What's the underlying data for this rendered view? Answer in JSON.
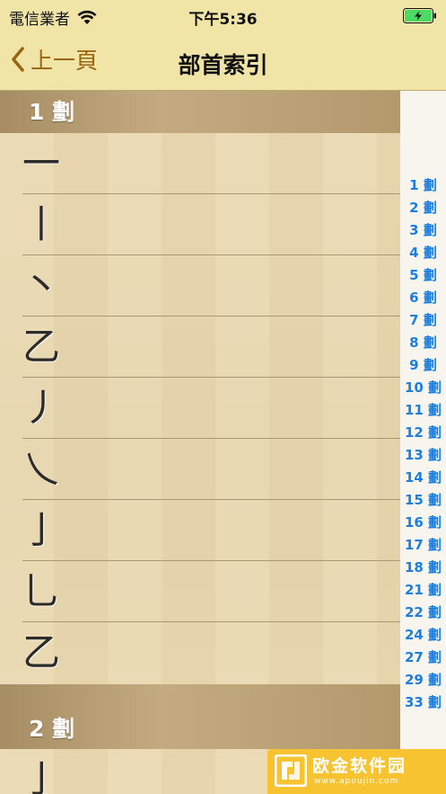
{
  "status_bar": {
    "carrier": "電信業者",
    "time": "下午5:36"
  },
  "nav": {
    "back_label": "上一頁",
    "title": "部首索引"
  },
  "sections": [
    {
      "header": "1 劃",
      "radicals": [
        "一",
        "丨",
        "丶",
        "乙",
        "丿",
        "乀",
        "亅",
        "乚",
        "乙"
      ]
    },
    {
      "header": "2 劃",
      "radicals": [
        "亅"
      ]
    }
  ],
  "index": [
    "1 劃",
    "2 劃",
    "3 劃",
    "4 劃",
    "5 劃",
    "6 劃",
    "7 劃",
    "8 劃",
    "9 劃",
    "10 劃",
    "11 劃",
    "12 劃",
    "13 劃",
    "14 劃",
    "15 劃",
    "16 劃",
    "17 劃",
    "18 劃",
    "21 劃",
    "22 劃",
    "24 劃",
    "27 劃",
    "29 劃",
    "33 劃"
  ],
  "colors": {
    "accent_back": "#9a6410",
    "index_link": "#1a7fe0",
    "battery": "#4cd964",
    "bar_background": "#f1e4a7"
  },
  "watermark": {
    "text": "欧金软件园",
    "sub": "www.apoujin.com"
  }
}
